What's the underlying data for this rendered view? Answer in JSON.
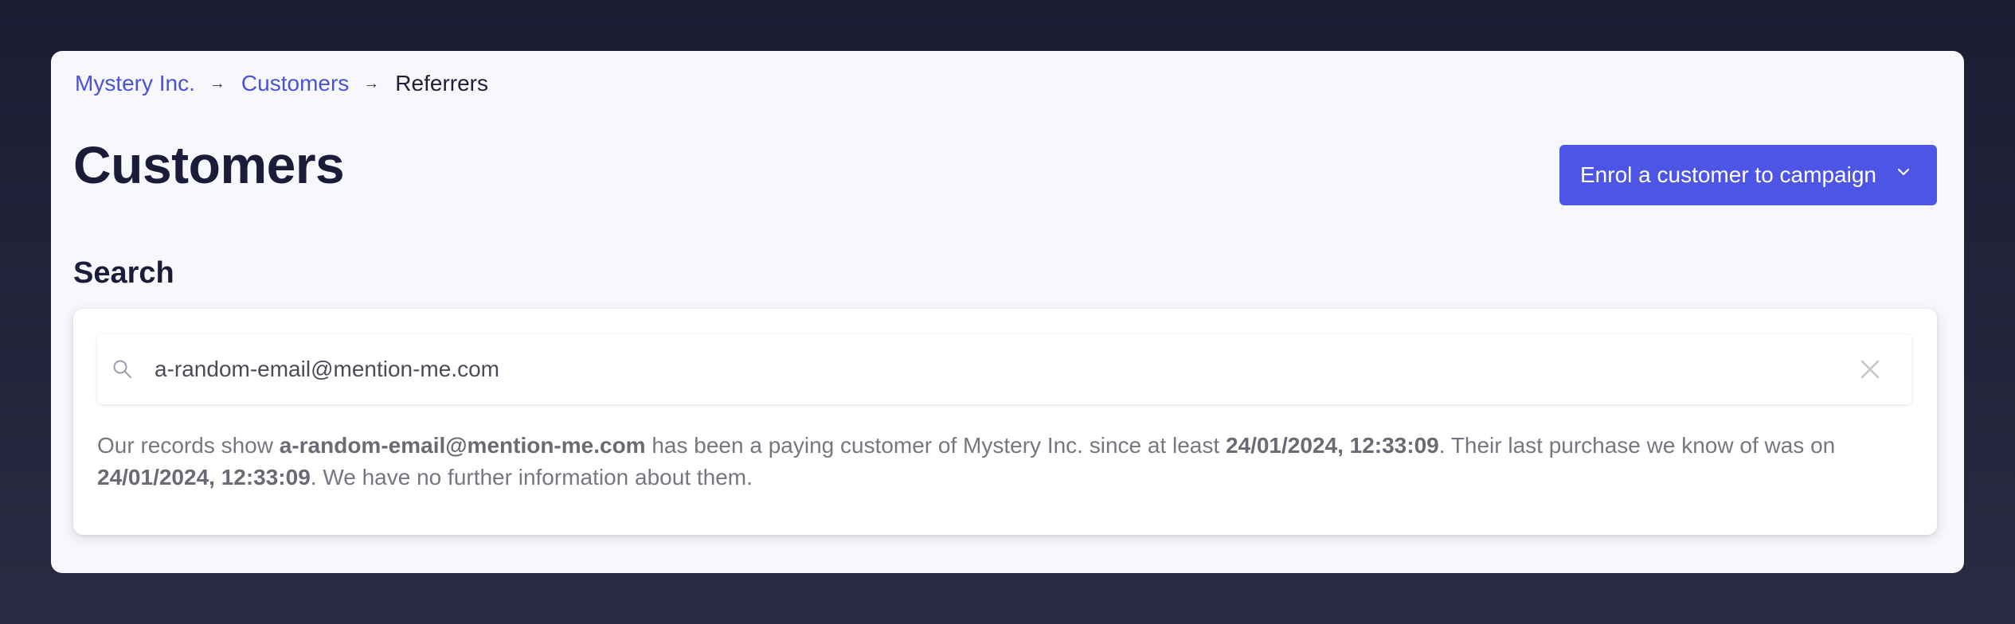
{
  "breadcrumb": {
    "items": [
      {
        "label": "Mystery Inc."
      },
      {
        "label": "Customers"
      },
      {
        "label": "Referrers"
      }
    ],
    "separator": "→"
  },
  "header": {
    "title": "Customers",
    "enrol_button_label": "Enrol a customer to campaign"
  },
  "search": {
    "section_title": "Search",
    "input_value": "a-random-email@mention-me.com",
    "result": {
      "prefix": "Our records show ",
      "email": "a-random-email@mention-me.com",
      "middle1": " has been a paying customer of Mystery Inc. since at least ",
      "since_date": "24/01/2024, 12:33:09",
      "middle2": ". Their last purchase we know of was on ",
      "last_purchase_date": "24/01/2024, 12:33:09",
      "suffix": ". We have no further information about them."
    }
  },
  "icons": {
    "search": "search-icon",
    "clear": "close-icon",
    "dropdown": "chevron-down-icon"
  },
  "colors": {
    "accent": "#4c55e6",
    "link": "#4a53d6",
    "title": "#1b1b3a"
  }
}
